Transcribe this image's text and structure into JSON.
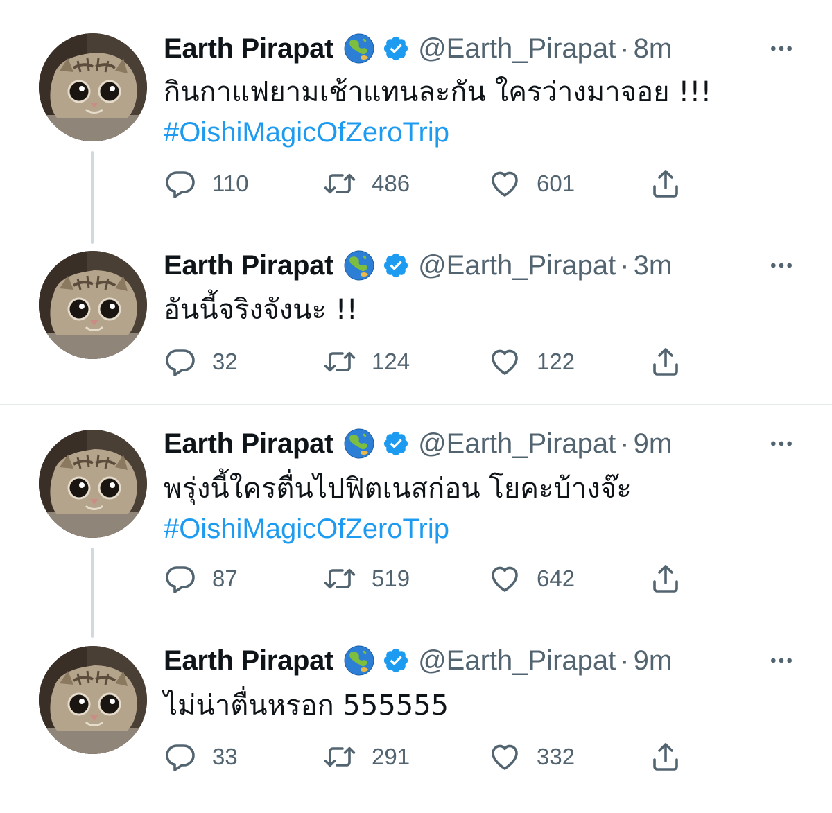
{
  "tweets": [
    {
      "name": "Earth Pirapat",
      "handle": "@Earth_Pirapat",
      "separator": "·",
      "time": "8m",
      "text": "กินกาแฟยามเช้าแทนละกัน ใครว่างมาจอย !!!",
      "hashtag": "#OishiMagicOfZeroTrip",
      "replies": "110",
      "retweets": "486",
      "likes": "601"
    },
    {
      "name": "Earth Pirapat",
      "handle": "@Earth_Pirapat",
      "separator": "·",
      "time": "3m",
      "text": "อันนี้จริงจังนะ !!",
      "hashtag": "",
      "replies": "32",
      "retweets": "124",
      "likes": "122"
    },
    {
      "name": "Earth Pirapat",
      "handle": "@Earth_Pirapat",
      "separator": "·",
      "time": "9m",
      "text": "พรุ่งนี้ใครตื่นไปฟิตเนสก่อน โยคะบ้างจ๊ะ",
      "hashtag": "#OishiMagicOfZeroTrip",
      "replies": "87",
      "retweets": "519",
      "likes": "642"
    },
    {
      "name": "Earth Pirapat",
      "handle": "@Earth_Pirapat",
      "separator": "·",
      "time": "9m",
      "text": "ไม่น่าตื่นหรอก 555555",
      "hashtag": "",
      "replies": "33",
      "retweets": "291",
      "likes": "332"
    }
  ],
  "icons": {
    "globe": "globe-asia-australia-icon",
    "verified": "verified-badge-icon",
    "more": "more-options-icon",
    "reply": "reply-icon",
    "retweet": "retweet-icon",
    "like": "heart-icon",
    "share": "share-icon"
  },
  "colors": {
    "text": "#0f1419",
    "secondary": "#536471",
    "link": "#1d9bf0",
    "verified": "#1d9bf0",
    "thread_line": "#cfd9de",
    "divider": "#e6e9ea"
  }
}
